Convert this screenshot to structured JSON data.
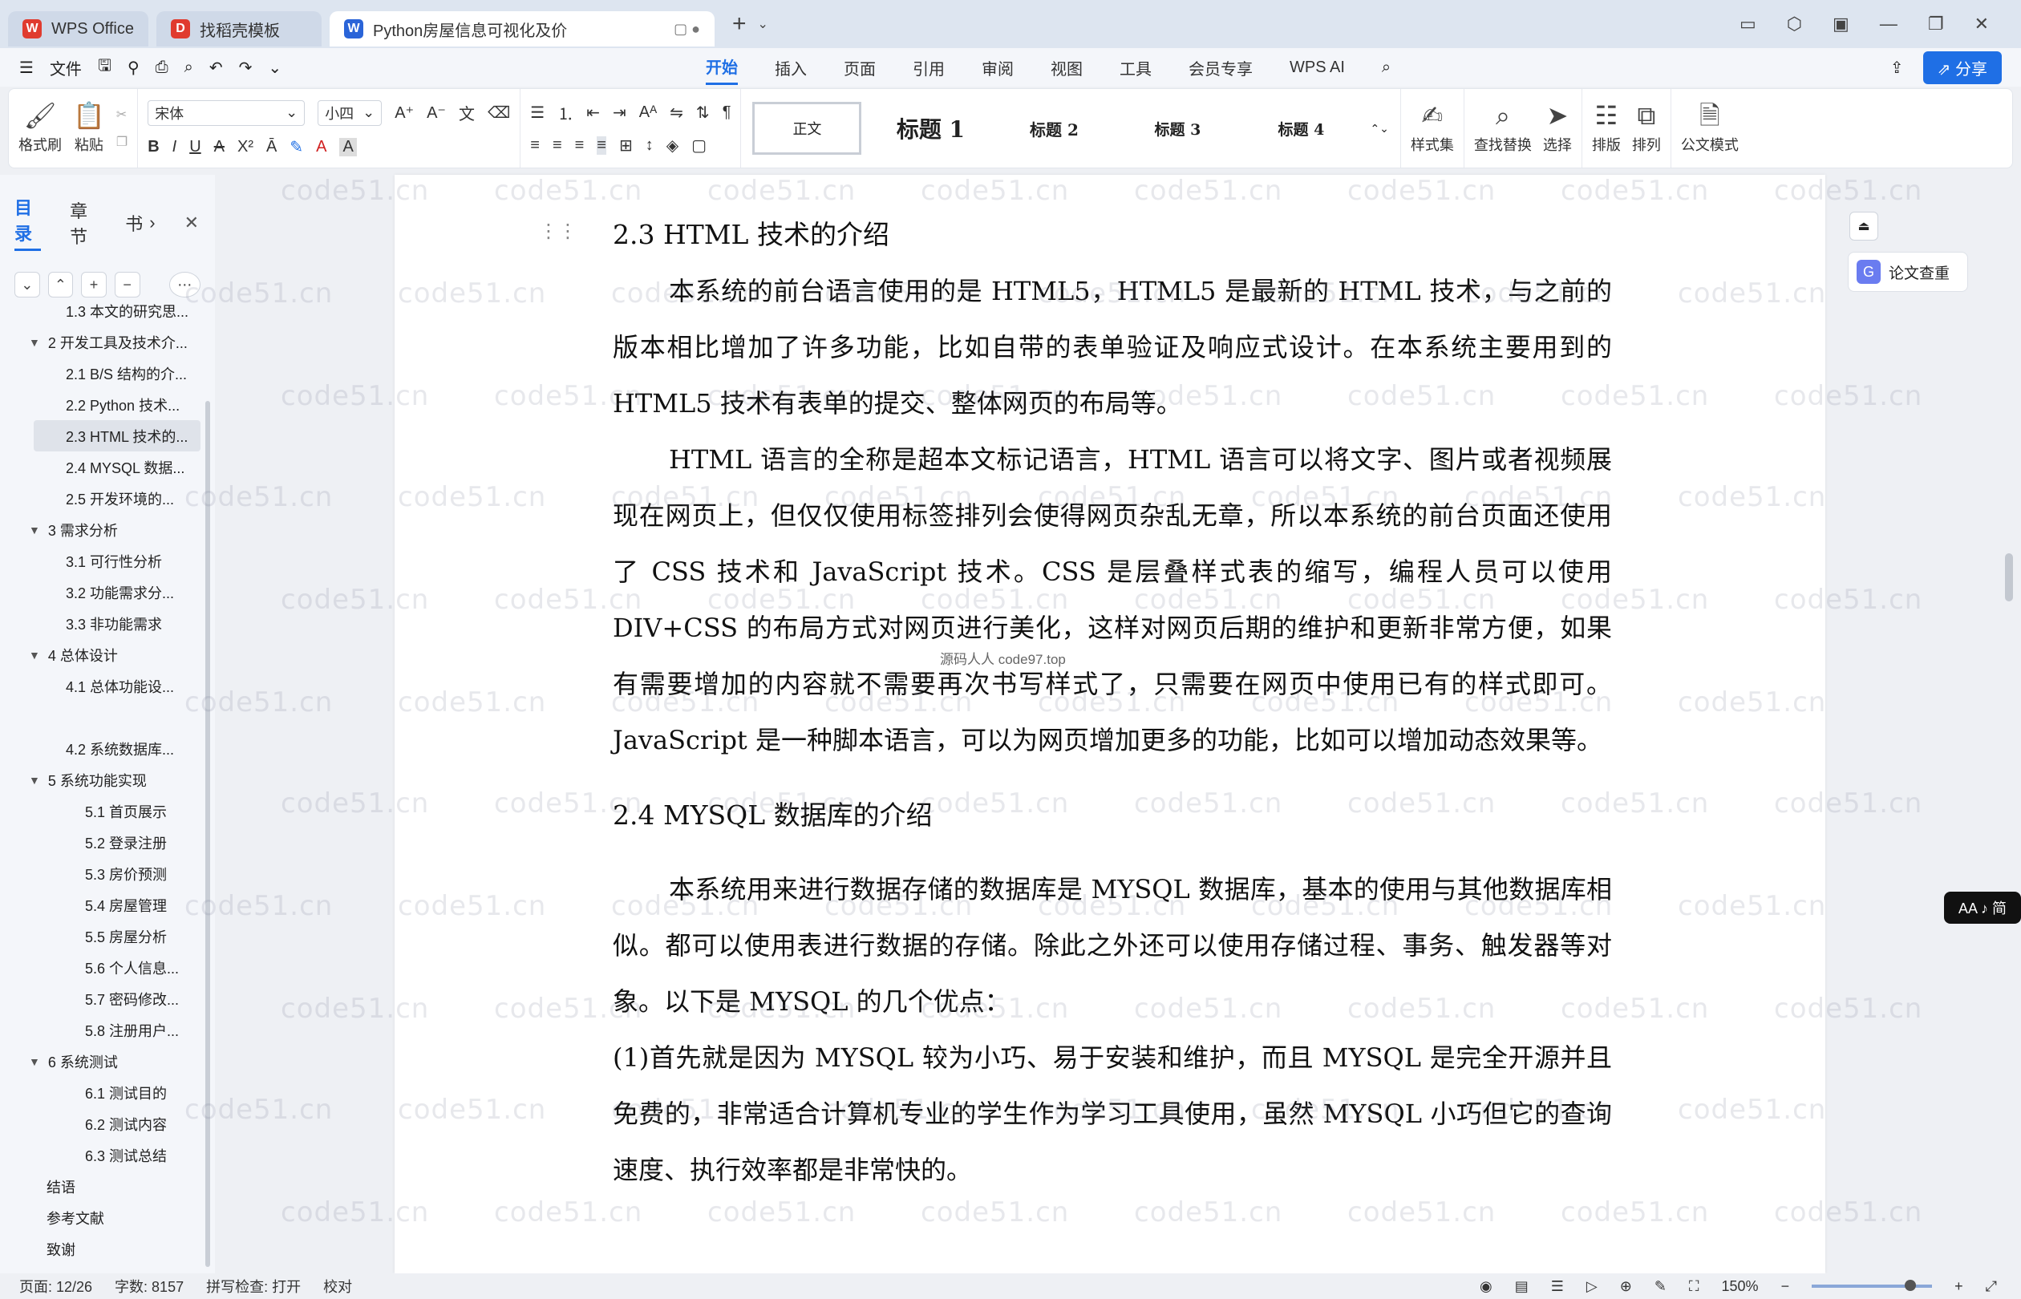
{
  "titlebar": {
    "tabs": [
      {
        "label": "WPS Office",
        "logo": "W",
        "logo_color": "#e03b2f"
      },
      {
        "label": "找稻壳模板",
        "logo": "D",
        "logo_color": "#e03b2f"
      },
      {
        "label": "Python房屋信息可视化及价",
        "logo": "W",
        "logo_color": "#2a64d8"
      }
    ],
    "new_tab": "+"
  },
  "menubar": {
    "file_label": "文件",
    "tabs": [
      "开始",
      "插入",
      "页面",
      "引用",
      "审阅",
      "视图",
      "工具",
      "会员专享",
      "WPS AI"
    ],
    "active_tab": "开始",
    "share_label": "分享"
  },
  "ribbon": {
    "format_painter": "格式刷",
    "paste": "粘贴",
    "font_name": "宋体",
    "font_size": "小四",
    "styles": [
      "正文",
      "标题 1",
      "标题 2",
      "标题 3",
      "标题 4"
    ],
    "style_set": "样式集",
    "find_replace": "查找替换",
    "select": "选择",
    "typeset": "排版",
    "arrange": "排列",
    "official_mode": "公文模式"
  },
  "sidebar": {
    "tabs": [
      "目录",
      "章节",
      "书"
    ],
    "toc": [
      {
        "label": "1.3 本文的研究思...",
        "level": "l2"
      },
      {
        "label": "2 开发工具及技术介...",
        "level": "l1"
      },
      {
        "label": "2.1 B/S 结构的介...",
        "level": "l2"
      },
      {
        "label": "2.2 Python 技术...",
        "level": "l2"
      },
      {
        "label": "2.3 HTML 技术的...",
        "level": "l2",
        "active": true
      },
      {
        "label": "2.4 MYSQL 数据...",
        "level": "l2"
      },
      {
        "label": "2.5 开发环境的...",
        "level": "l2"
      },
      {
        "label": "3 需求分析",
        "level": "l1"
      },
      {
        "label": "3.1 可行性分析",
        "level": "l2"
      },
      {
        "label": "3.2 功能需求分...",
        "level": "l2"
      },
      {
        "label": "3.3 非功能需求",
        "level": "l2"
      },
      {
        "label": "4 总体设计",
        "level": "l1"
      },
      {
        "label": "4.1 总体功能设...",
        "level": "l2"
      },
      {
        "label": "",
        "level": "l2"
      },
      {
        "label": "4.2 系统数据库...",
        "level": "l2"
      },
      {
        "label": "5 系统功能实现",
        "level": "l1"
      },
      {
        "label": "5.1 首页展示",
        "level": "l3"
      },
      {
        "label": "5.2 登录注册",
        "level": "l3"
      },
      {
        "label": "5.3 房价预测",
        "level": "l3"
      },
      {
        "label": "5.4 房屋管理",
        "level": "l3"
      },
      {
        "label": "5.5 房屋分析",
        "level": "l3"
      },
      {
        "label": "5.6 个人信息...",
        "level": "l3"
      },
      {
        "label": "5.7 密码修改...",
        "level": "l3"
      },
      {
        "label": "5.8 注册用户...",
        "level": "l3"
      },
      {
        "label": "6 系统测试",
        "level": "l1"
      },
      {
        "label": "6.1 测试目的",
        "level": "l3"
      },
      {
        "label": "6.2 测试内容",
        "level": "l3"
      },
      {
        "label": "6.3 测试总结",
        "level": "l3"
      },
      {
        "label": "结语",
        "level": "l0"
      },
      {
        "label": "参考文献",
        "level": "l0"
      },
      {
        "label": "致谢",
        "level": "l0"
      }
    ]
  },
  "document": {
    "h1": "2.3 HTML 技术的介绍",
    "p1": "本系统的前台语言使用的是 HTML5，HTML5 是最新的 HTML 技术，与之前的版本相比增加了许多功能，比如自带的表单验证及响应式设计。在本系统主要用到的 HTML5 技术有表单的提交、整体网页的布局等。",
    "p2": "HTML 语言的全称是超本文标记语言，HTML 语言可以将文字、图片或者视频展现在网页上，但仅仅使用标签排列会使得网页杂乱无章，所以本系统的前台页面还使用了 CSS 技术和 JavaScript 技术。CSS 是层叠样式表的缩写，编程人员可以使用 DIV+CSS 的布局方式对网页进行美化，这样对网页后期的维护和更新非常方便，如果有需要增加的内容就不需要再次书写样式了，只需要在网页中使用已有的样式即可。JavaScript 是一种脚本语言，可以为网页增加更多的功能，比如可以增加动态效果等。",
    "h2": "2.4 MYSQL 数据库的介绍",
    "p3": "本系统用来进行数据存储的数据库是 MYSQL 数据库，基本的使用与其他数据库相似。都可以使用表进行数据的存储。除此之外还可以使用存储过程、事务、触发器等对象。以下是 MYSQL 的几个优点：",
    "p4": "(1)首先就是因为 MYSQL 较为小巧、易于安装和维护，而且 MYSQL 是完全开源并且免费的，非常适合计算机专业的学生作为学习工具使用，虽然 MYSQL 小巧但它的查询速度、执行效率都是非常快的。",
    "watermark": "code51.cn",
    "inline_watermark": "源码人人 code97.top"
  },
  "right_panel": {
    "check_label": "论文查重",
    "aa_label": "AA ♪ 简"
  },
  "statusbar": {
    "page": "页面: 12/26",
    "words": "字数: 8157",
    "spell": "拼写检查: 打开",
    "proof": "校对",
    "zoom": "150%"
  }
}
